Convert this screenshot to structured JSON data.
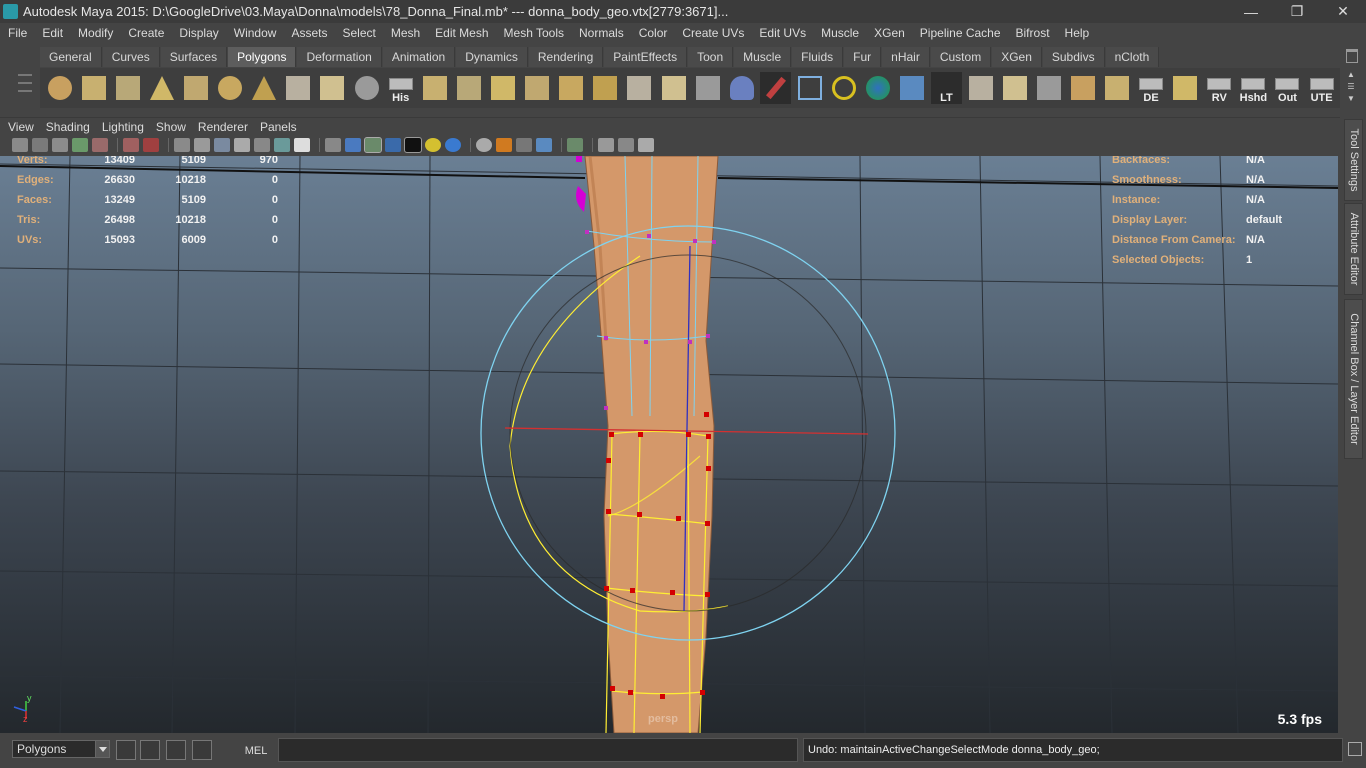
{
  "window": {
    "title": "Autodesk Maya 2015: D:\\GoogleDrive\\03.Maya\\Donna\\models\\78_Donna_Final.mb*   ---   donna_body_geo.vtx[2779:3671]...",
    "minimize": "—",
    "restore": "❐",
    "close": "✕"
  },
  "menubar": [
    "File",
    "Edit",
    "Modify",
    "Create",
    "Display",
    "Window",
    "Assets",
    "Select",
    "Mesh",
    "Edit Mesh",
    "Mesh Tools",
    "Normals",
    "Color",
    "Create UVs",
    "Edit UVs",
    "Muscle",
    "XGen",
    "Pipeline Cache",
    "Bifrost",
    "Help"
  ],
  "shelf": {
    "tabs": [
      "General",
      "Curves",
      "Surfaces",
      "Polygons",
      "Deformation",
      "Animation",
      "Dynamics",
      "Rendering",
      "PaintEffects",
      "Toon",
      "Muscle",
      "Fluids",
      "Fur",
      "nHair",
      "Custom",
      "XGen",
      "Subdivs",
      "nCloth"
    ],
    "active_tab": "Polygons",
    "icons": [
      {
        "name": "poly-sphere-icon",
        "label": ""
      },
      {
        "name": "poly-cube-icon",
        "label": ""
      },
      {
        "name": "poly-cylinder-icon",
        "label": ""
      },
      {
        "name": "poly-cone-icon",
        "label": ""
      },
      {
        "name": "poly-plane-icon",
        "label": ""
      },
      {
        "name": "poly-torus-icon",
        "label": ""
      },
      {
        "name": "poly-pyramid-icon",
        "label": ""
      },
      {
        "name": "poly-pipe-icon",
        "label": ""
      },
      {
        "name": "append-polygon-icon",
        "label": ""
      },
      {
        "name": "soccer-ball-icon",
        "label": ""
      },
      {
        "name": "history-icon",
        "label": "His"
      },
      {
        "name": "extrude-icon",
        "label": ""
      },
      {
        "name": "bevel-icon",
        "label": ""
      },
      {
        "name": "bridge-icon",
        "label": ""
      },
      {
        "name": "split-icon",
        "label": ""
      },
      {
        "name": "insert-loop-icon",
        "label": ""
      },
      {
        "name": "offset-loop-icon",
        "label": ""
      },
      {
        "name": "merge-icon",
        "label": ""
      },
      {
        "name": "uv-planar-icon",
        "label": ""
      },
      {
        "name": "uv-auto-icon",
        "label": ""
      },
      {
        "name": "sculpt-icon",
        "label": ""
      },
      {
        "name": "paint-brush-icon",
        "label": ""
      },
      {
        "name": "wireframe-cube-icon",
        "label": ""
      },
      {
        "name": "target-icon",
        "label": ""
      },
      {
        "name": "globe-icon",
        "label": ""
      },
      {
        "name": "render-box-icon",
        "label": ""
      },
      {
        "name": "lt-icon",
        "label": "LT"
      },
      {
        "name": "mesh-select-1-icon",
        "label": ""
      },
      {
        "name": "mesh-select-2-icon",
        "label": ""
      },
      {
        "name": "mesh-select-3-icon",
        "label": ""
      },
      {
        "name": "mesh-select-4-icon",
        "label": ""
      },
      {
        "name": "mesh-select-5-icon",
        "label": ""
      },
      {
        "name": "de-icon",
        "label": "DE"
      },
      {
        "name": "mesh-select-6-icon",
        "label": ""
      },
      {
        "name": "rv-icon",
        "label": "RV"
      },
      {
        "name": "hshd-icon",
        "label": "Hshd"
      },
      {
        "name": "out-icon",
        "label": "Out"
      },
      {
        "name": "ute-icon",
        "label": "UTE"
      }
    ]
  },
  "panel_menu": [
    "View",
    "Shading",
    "Lighting",
    "Show",
    "Renderer",
    "Panels"
  ],
  "hud": {
    "left": [
      {
        "label": "Verts:",
        "v1": "13409",
        "v2": "5109",
        "v3": "970"
      },
      {
        "label": "Edges:",
        "v1": "26630",
        "v2": "10218",
        "v3": "0"
      },
      {
        "label": "Faces:",
        "v1": "13249",
        "v2": "5109",
        "v3": "0"
      },
      {
        "label": "Tris:",
        "v1": "26498",
        "v2": "10218",
        "v3": "0"
      },
      {
        "label": "UVs:",
        "v1": "15093",
        "v2": "6009",
        "v3": "0"
      }
    ],
    "right": [
      {
        "label": "Backfaces:",
        "value": "N/A"
      },
      {
        "label": "Smoothness:",
        "value": "N/A"
      },
      {
        "label": "Instance:",
        "value": "N/A"
      },
      {
        "label": "Display Layer:",
        "value": "default"
      },
      {
        "label": "Distance From Camera:",
        "value": "N/A"
      },
      {
        "label": "Selected Objects:",
        "value": "1"
      }
    ],
    "fps": "5.3 fps",
    "camera": "persp",
    "axis_y": "y",
    "axis_z": "z"
  },
  "side_tabs": [
    "Tool Settings",
    "Attribute Editor",
    "Channel Box / Layer Editor"
  ],
  "bottom": {
    "mode": "Polygons",
    "mel_label": "MEL",
    "mel_value": "",
    "undo_line": "Undo: maintainActiveChangeSelectMode donna_body_geo;"
  },
  "colors": {
    "selection_yellow": "#ffee33",
    "manipulator_cyan": "#7fd3f0",
    "skin": "#d9a072",
    "vertex_red": "#d40000"
  }
}
